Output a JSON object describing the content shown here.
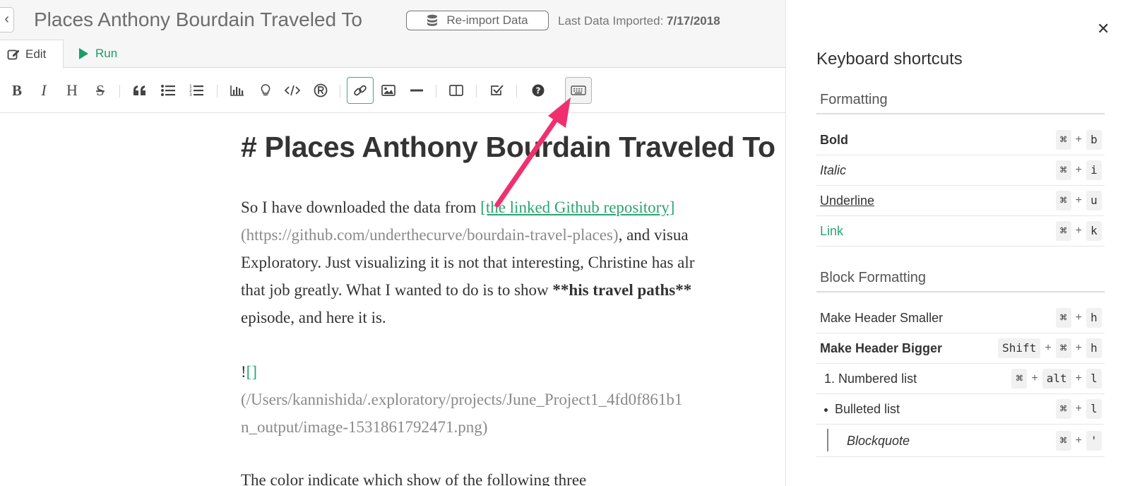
{
  "header": {
    "back_icon": "chevron-left-icon",
    "title": "Places Anthony Bourdain Traveled To",
    "reimport_label": "Re-import Data",
    "reimport_icon": "database-icon",
    "last_imported_label": "Last Data Imported:",
    "last_imported_date": "7/17/2018"
  },
  "tabs": {
    "edit_label": "Edit",
    "edit_icon": "pencil-square-icon",
    "run_label": "Run",
    "run_icon": "play-icon"
  },
  "toolbar": {
    "bold": "B",
    "italic": "I",
    "heading": "H",
    "strike": "S",
    "active_tool": "keyboard",
    "highlight_color": "#39b07e"
  },
  "editor": {
    "heading": "# Places Anthony Bourdain Traveled To",
    "p1_line1_pre": "So I have downloaded the data from ",
    "p1_link": "[the linked Github repository]",
    "p1_line2_url": "(https://github.com/underthecurve/bourdain-travel-places)",
    "p1_line2_post": ", and visua",
    "p1_line3": "Exploratory. Just visualizing it is not that interesting, Christine has alr",
    "p1_line4_pre": "that job greatly. What I wanted to do is to show ",
    "p1_line4_bold": "**his travel paths**",
    "p1_line5": "episode, and here it is.",
    "img_bang": "!",
    "img_brackets": "[]",
    "img_path1": "(/Users/kannishida/.exploratory/projects/June_Project1_4fd0f861b1",
    "img_path2": "n_output/image-1531861792471.png)",
    "p2_line1": "The color indicate which show of the following three"
  },
  "shortcuts": {
    "close_icon": "close-icon",
    "title": "Keyboard shortcuts",
    "formatting_header": "Formatting",
    "block_header": "Block Formatting",
    "cmd": "⌘",
    "plus": "+",
    "formatting": [
      {
        "label": "Bold",
        "key": "b"
      },
      {
        "label": "Italic",
        "key": "i"
      },
      {
        "label": "Underline",
        "key": "u"
      },
      {
        "label": "Link",
        "key": "k"
      }
    ],
    "block": {
      "smaller_label": "Make Header Smaller",
      "smaller_key": "h",
      "bigger_label": "Make Header Bigger",
      "shift": "Shift",
      "bigger_key": "h",
      "numbered_prefix": "1.",
      "numbered_label": "Numbered list",
      "alt": "alt",
      "numbered_key": "l",
      "bulleted_label": "Bulleted list",
      "bulleted_key": "l",
      "quote_label": "Blockquote",
      "quote_key": "'"
    }
  },
  "colors": {
    "accent_green": "#2aa56f",
    "arrow_pink": "#f0306e"
  }
}
